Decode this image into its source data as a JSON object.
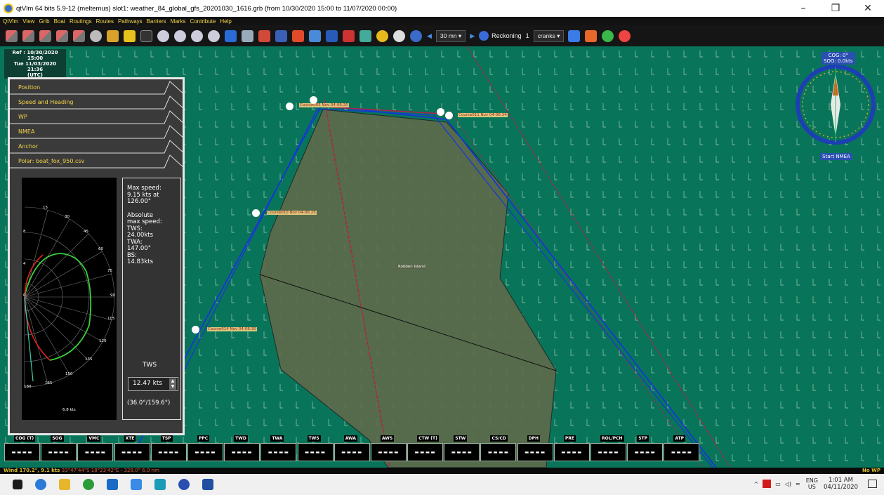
{
  "window": {
    "title": "qtVlm 64 bits 5.9-12 (meltemus) slot1: weather_84_global_gfs_20201030_1616.grb (from 10/30/2020 15:00 to 11/07/2020 00:00)",
    "minimize": "–",
    "maximize": "❐",
    "close": "✕"
  },
  "menu": [
    "QtVlm",
    "View",
    "Grib",
    "Boat",
    "Routings",
    "Routes",
    "Pathways",
    "Barriers",
    "Marks",
    "Contribute",
    "Help"
  ],
  "toolbar": {
    "interval": "30 mn",
    "reckoning_label": "Reckoning",
    "crank_count": "1",
    "cranks_label": "cranks"
  },
  "map": {
    "ref_line1": "Ref : 10/30/2020 15:00",
    "ref_line2": "Tue 11/03/2020 21:36",
    "ref_line3": "(UTC)",
    "cog": "COG: 0°",
    "sog": "SOG: 0.0kts",
    "start_nmea": "Start NMEA",
    "island_label": "Robben Island",
    "wp_labels": [
      "Course005 Nov 04-06:20",
      "Course011 Nov 04-06:34",
      "Course010 Nov 04-06:25",
      "Course014 Nov 04-06:30"
    ]
  },
  "panel": {
    "tabs": [
      "Position",
      "Speed and Heading",
      "WP",
      "NMEA",
      "Anchor",
      "Polar: boat_fox_950.csv"
    ],
    "polar_ticks": [
      "15",
      "30",
      "45",
      "60",
      "75",
      "90",
      "105",
      "120",
      "135",
      "150",
      "165",
      "180"
    ],
    "polar_rings": [
      "8",
      "4",
      "0"
    ],
    "polar_speed": "6.8 kts",
    "info": {
      "max_speed_title": "Max speed:",
      "max_speed_value": "9.15 kts at",
      "max_speed_angle": "126.00°",
      "abs_title": "Absolute",
      "abs_title2": "max speed:",
      "tws_title": "TWS:",
      "tws_value": "24.00kts",
      "twa_title": "TWA:",
      "twa_value": "147.00°",
      "bs_title": "BS:",
      "bs_value": "14.83kts"
    },
    "tws_label": "TWS",
    "tws_spin": "12.47 kts",
    "tws_range": "(36.0°/159.6°)"
  },
  "instruments": [
    {
      "label": "COG (T)",
      "value": "----"
    },
    {
      "label": "SOG",
      "value": "----"
    },
    {
      "label": "VMC",
      "value": "----"
    },
    {
      "label": "XTE",
      "value": "----"
    },
    {
      "label": "TSP",
      "value": "----"
    },
    {
      "label": "PPC",
      "value": "----"
    },
    {
      "label": "TWD",
      "value": "----"
    },
    {
      "label": "TWA",
      "value": "----"
    },
    {
      "label": "TWS",
      "value": "----"
    },
    {
      "label": "AWA",
      "value": "----"
    },
    {
      "label": "AWS",
      "value": "----"
    },
    {
      "label": "CTW (T)",
      "value": "----"
    },
    {
      "label": "STW",
      "value": "----"
    },
    {
      "label": "CS/CD",
      "value": "----"
    },
    {
      "label": "DPH",
      "value": "----"
    },
    {
      "label": "PRE",
      "value": "----"
    },
    {
      "label": "ROL/PCH",
      "value": "----"
    },
    {
      "label": "STP",
      "value": "----"
    },
    {
      "label": "ATP",
      "value": "----"
    }
  ],
  "status": {
    "wind": "Wind 170.2°, 9.1 kts",
    "position": "33°47'44\"S 18°23'42\"E - 328.0° 6.0 nm",
    "right": "No WP"
  },
  "taskbar": {
    "lang1": "ENG",
    "lang2": "US",
    "time": "1:01 AM",
    "date": "04/11/2020"
  },
  "colors": {
    "sea": "#08755a",
    "land": "#5f6a4a",
    "route_blue": "#1637d6",
    "route_red": "#b0224a",
    "label_yellow": "#f2d64b"
  }
}
